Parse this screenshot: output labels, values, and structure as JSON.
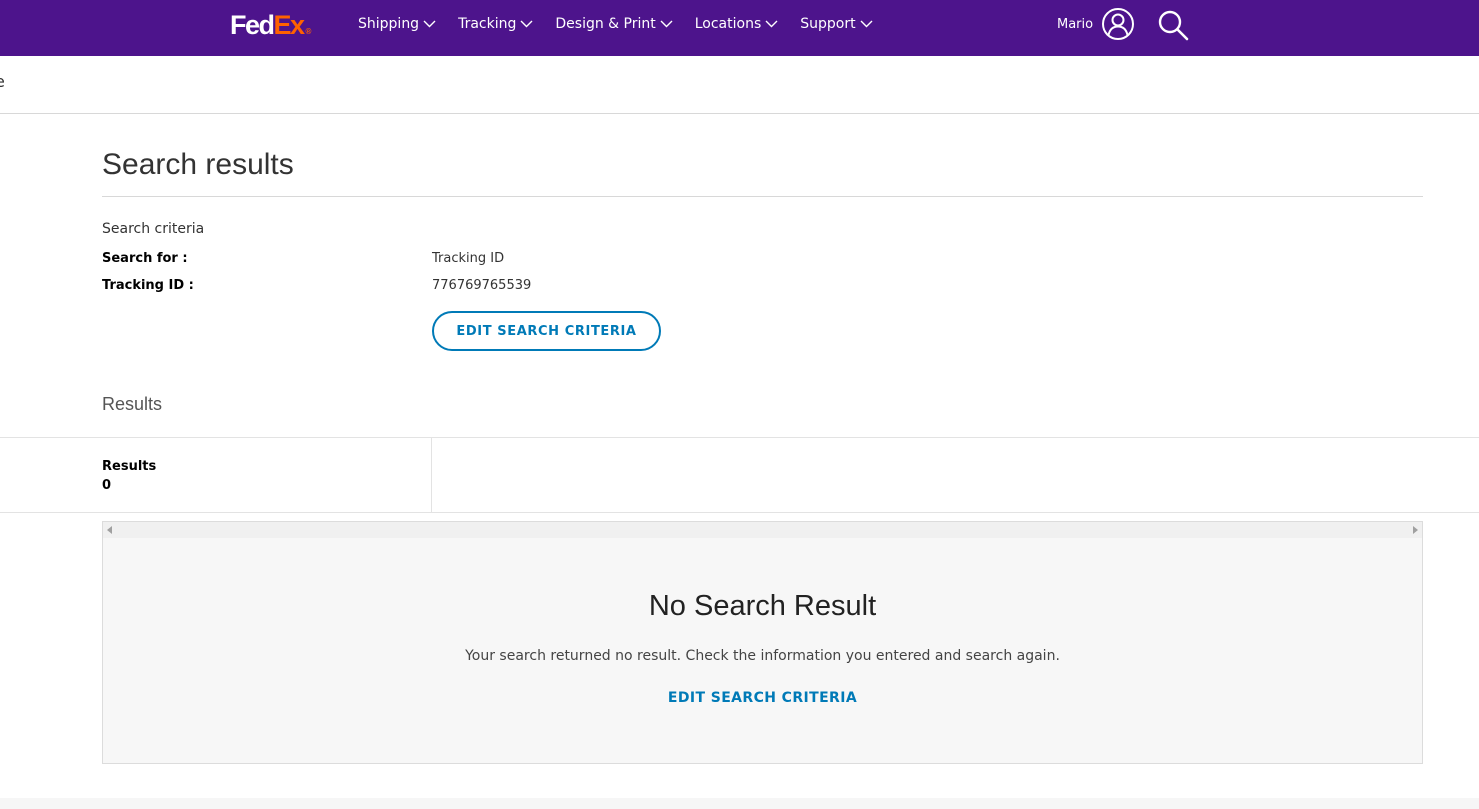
{
  "header": {
    "logo_fed": "Fed",
    "logo_ex": "Ex",
    "logo_dot": "®",
    "nav": [
      {
        "label": "Shipping"
      },
      {
        "label": "Tracking"
      },
      {
        "label": "Design & Print"
      },
      {
        "label": "Locations"
      },
      {
        "label": "Support"
      }
    ],
    "user_name": "Mario"
  },
  "subbar": {
    "text": "e"
  },
  "main": {
    "title": "Search results",
    "criteria_heading": "Search criteria",
    "criteria": [
      {
        "label": "Search for :",
        "value": "Tracking ID"
      },
      {
        "label": "Tracking ID :",
        "value": "776769765539"
      }
    ],
    "edit_button_label": "EDIT SEARCH CRITERIA",
    "results_heading": "Results",
    "results_label": "Results",
    "results_count": "0",
    "empty": {
      "title": "No Search Result",
      "message": "Your search returned no result. Check the information you entered and search again.",
      "link_label": "EDIT SEARCH CRITERIA"
    }
  },
  "colors": {
    "brand_purple": "#4d148c",
    "brand_orange": "#ff6200",
    "link_blue": "#007ab7"
  }
}
